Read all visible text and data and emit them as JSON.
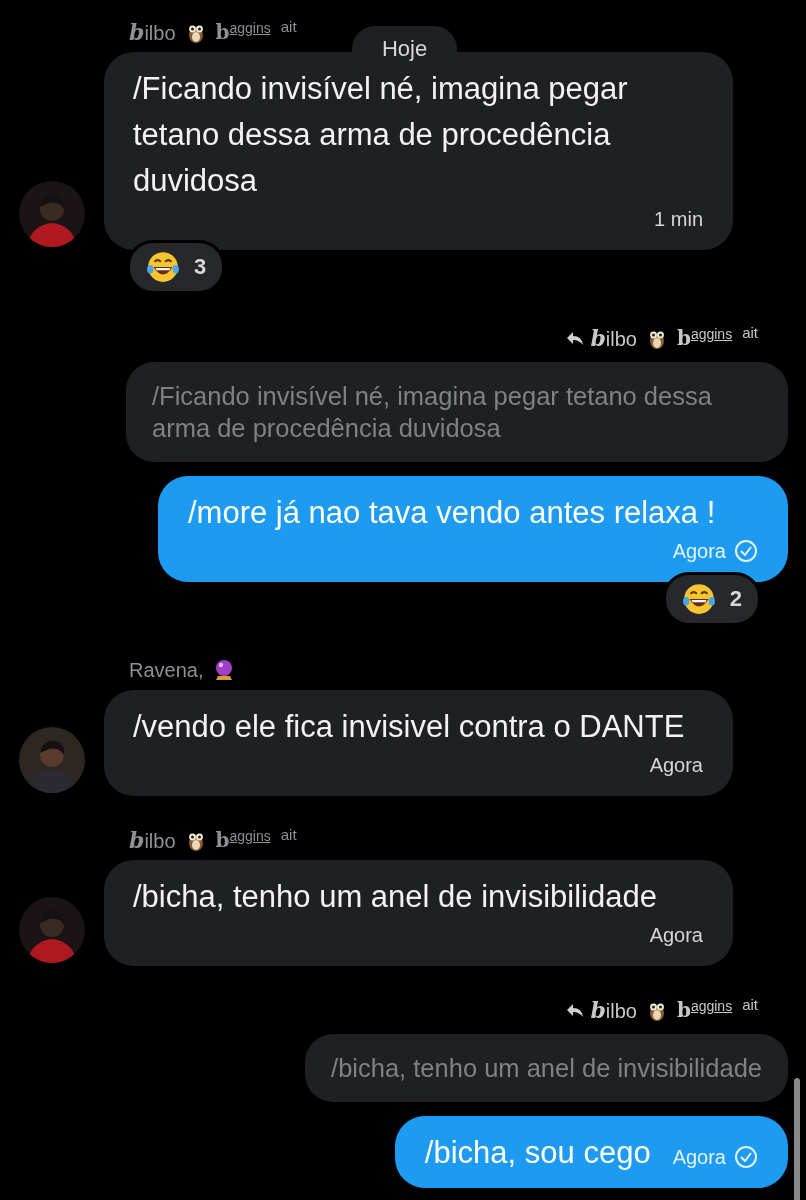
{
  "date_pill": "Hoje",
  "messages": [
    {
      "kind": "incoming",
      "sender": {
        "kind": "styled",
        "first": "**b**ilbo",
        "last": "**b**$^{aggins}$",
        "suffix": "ait"
      },
      "text": "/Ficando invisível né, imagina pegar tetano dessa arma de procedência duvidosa",
      "time": "1 min",
      "reaction": {
        "count": "3"
      }
    },
    {
      "kind": "outgoing",
      "reply_to": {
        "sender": {
          "kind": "styled",
          "first": "**b**ilbo",
          "last": "**b**$^{aggins}$",
          "suffix": "ait"
        },
        "text": "/Ficando invisível né, imagina pegar tetano dessa arma de procedência duvidosa"
      },
      "text": "/more já nao tava vendo antes relaxa !",
      "time": "Agora",
      "read": true,
      "reaction": {
        "count": "2"
      }
    },
    {
      "kind": "incoming",
      "sender": {
        "kind": "plain",
        "first": "Ravena,"
      },
      "text": "/vendo ele fica invisivel contra o DANTE",
      "time": "Agora"
    },
    {
      "kind": "incoming",
      "sender": {
        "kind": "styled",
        "first": "**b**ilbo",
        "last": "**b**$^{aggins}$",
        "suffix": "ait"
      },
      "text": "/bicha, tenho um anel de invisibilidade",
      "time": "Agora"
    },
    {
      "kind": "outgoing",
      "reply_to": {
        "sender": {
          "kind": "styled",
          "first": "**b**ilbo",
          "last": "**b**$^{aggins}$",
          "suffix": "ait"
        },
        "text": "/bicha, tenho um anel de invisibilidade"
      },
      "text": "/bicha, sou cego",
      "time": "Agora",
      "read": true
    }
  ]
}
